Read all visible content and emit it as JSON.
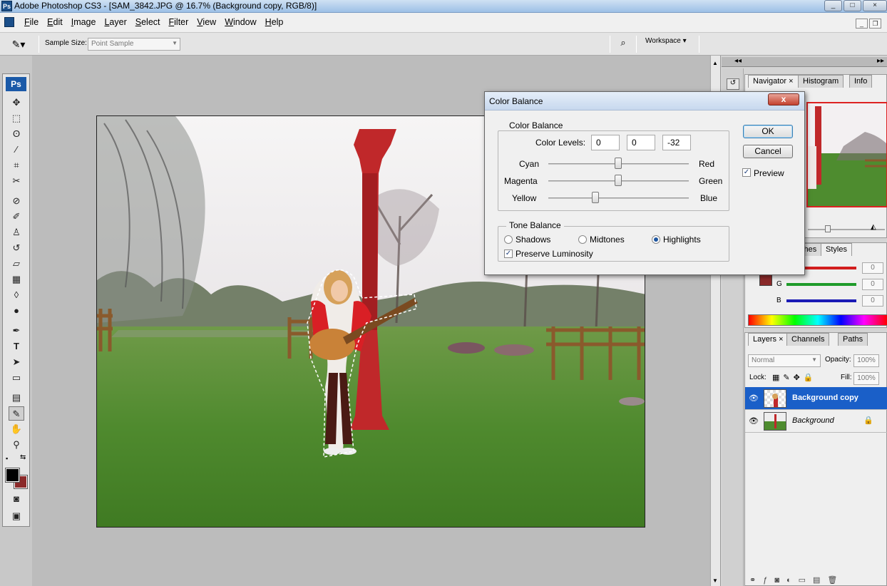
{
  "app": {
    "title": "Adobe Photoshop CS3 - [SAM_3842.JPG @ 16.7% (Background copy, RGB/8)]",
    "logo": "Ps"
  },
  "window_buttons": [
    "_",
    "□",
    "×"
  ],
  "menu": [
    "File",
    "Edit",
    "Image",
    "Layer",
    "Select",
    "Filter",
    "View",
    "Window",
    "Help"
  ],
  "options": {
    "sample_size_label": "Sample Size:",
    "sample_size_value": "Point Sample",
    "workspace_label": "Workspace ▾"
  },
  "toolbox": {
    "logo": "Ps",
    "tools": [
      "move-tool",
      "marquee-tool",
      "lasso-tool",
      "magic-wand-tool",
      "crop-tool",
      "slice-tool",
      "healing-brush-tool",
      "brush-tool",
      "clone-stamp-tool",
      "history-brush-tool",
      "eraser-tool",
      "gradient-tool",
      "blur-tool",
      "dodge-tool",
      "pen-tool",
      "type-tool",
      "path-selection-tool",
      "shape-tool",
      "notes-tool",
      "eyedropper-tool",
      "hand-tool",
      "zoom-tool"
    ],
    "foreground_color": "#000000",
    "background_color": "#8b2a2a"
  },
  "navigator": {
    "tabs": [
      "Navigator",
      "Histogram",
      "Info"
    ]
  },
  "color_panel": {
    "tabs": [
      "ches",
      "Styles"
    ],
    "channels": [
      {
        "label": "",
        "value": "0",
        "color": "#d21d1d"
      },
      {
        "label": "G",
        "value": "0",
        "color": "#1f9b2a"
      },
      {
        "label": "B",
        "value": "0",
        "color": "#1a1ab5"
      }
    ]
  },
  "layers_panel": {
    "tabs": [
      "Layers",
      "Channels",
      "Paths"
    ],
    "blend_mode": "Normal",
    "opacity_label": "Opacity:",
    "opacity_value": "100%",
    "lock_label": "Lock:",
    "fill_label": "Fill:",
    "fill_value": "100%",
    "layers": [
      {
        "name": "Background copy",
        "selected": true
      },
      {
        "name": "Background",
        "selected": false
      }
    ]
  },
  "dialog": {
    "title": "Color Balance",
    "close": "x",
    "color_balance_group": "Color Balance",
    "color_levels_label": "Color Levels:",
    "levels": [
      "0",
      "0",
      "-32"
    ],
    "sliders": [
      {
        "left": "Cyan",
        "right": "Red",
        "value": 0
      },
      {
        "left": "Magenta",
        "right": "Green",
        "value": 0
      },
      {
        "left": "Yellow",
        "right": "Blue",
        "value": -32
      }
    ],
    "tone_balance_group": "Tone Balance",
    "tones": [
      {
        "label": "Shadows",
        "checked": false
      },
      {
        "label": "Midtones",
        "checked": false
      },
      {
        "label": "Highlights",
        "checked": true
      }
    ],
    "preserve_luminosity": "Preserve Luminosity",
    "ok": "OK",
    "cancel": "Cancel",
    "preview": "Preview"
  }
}
